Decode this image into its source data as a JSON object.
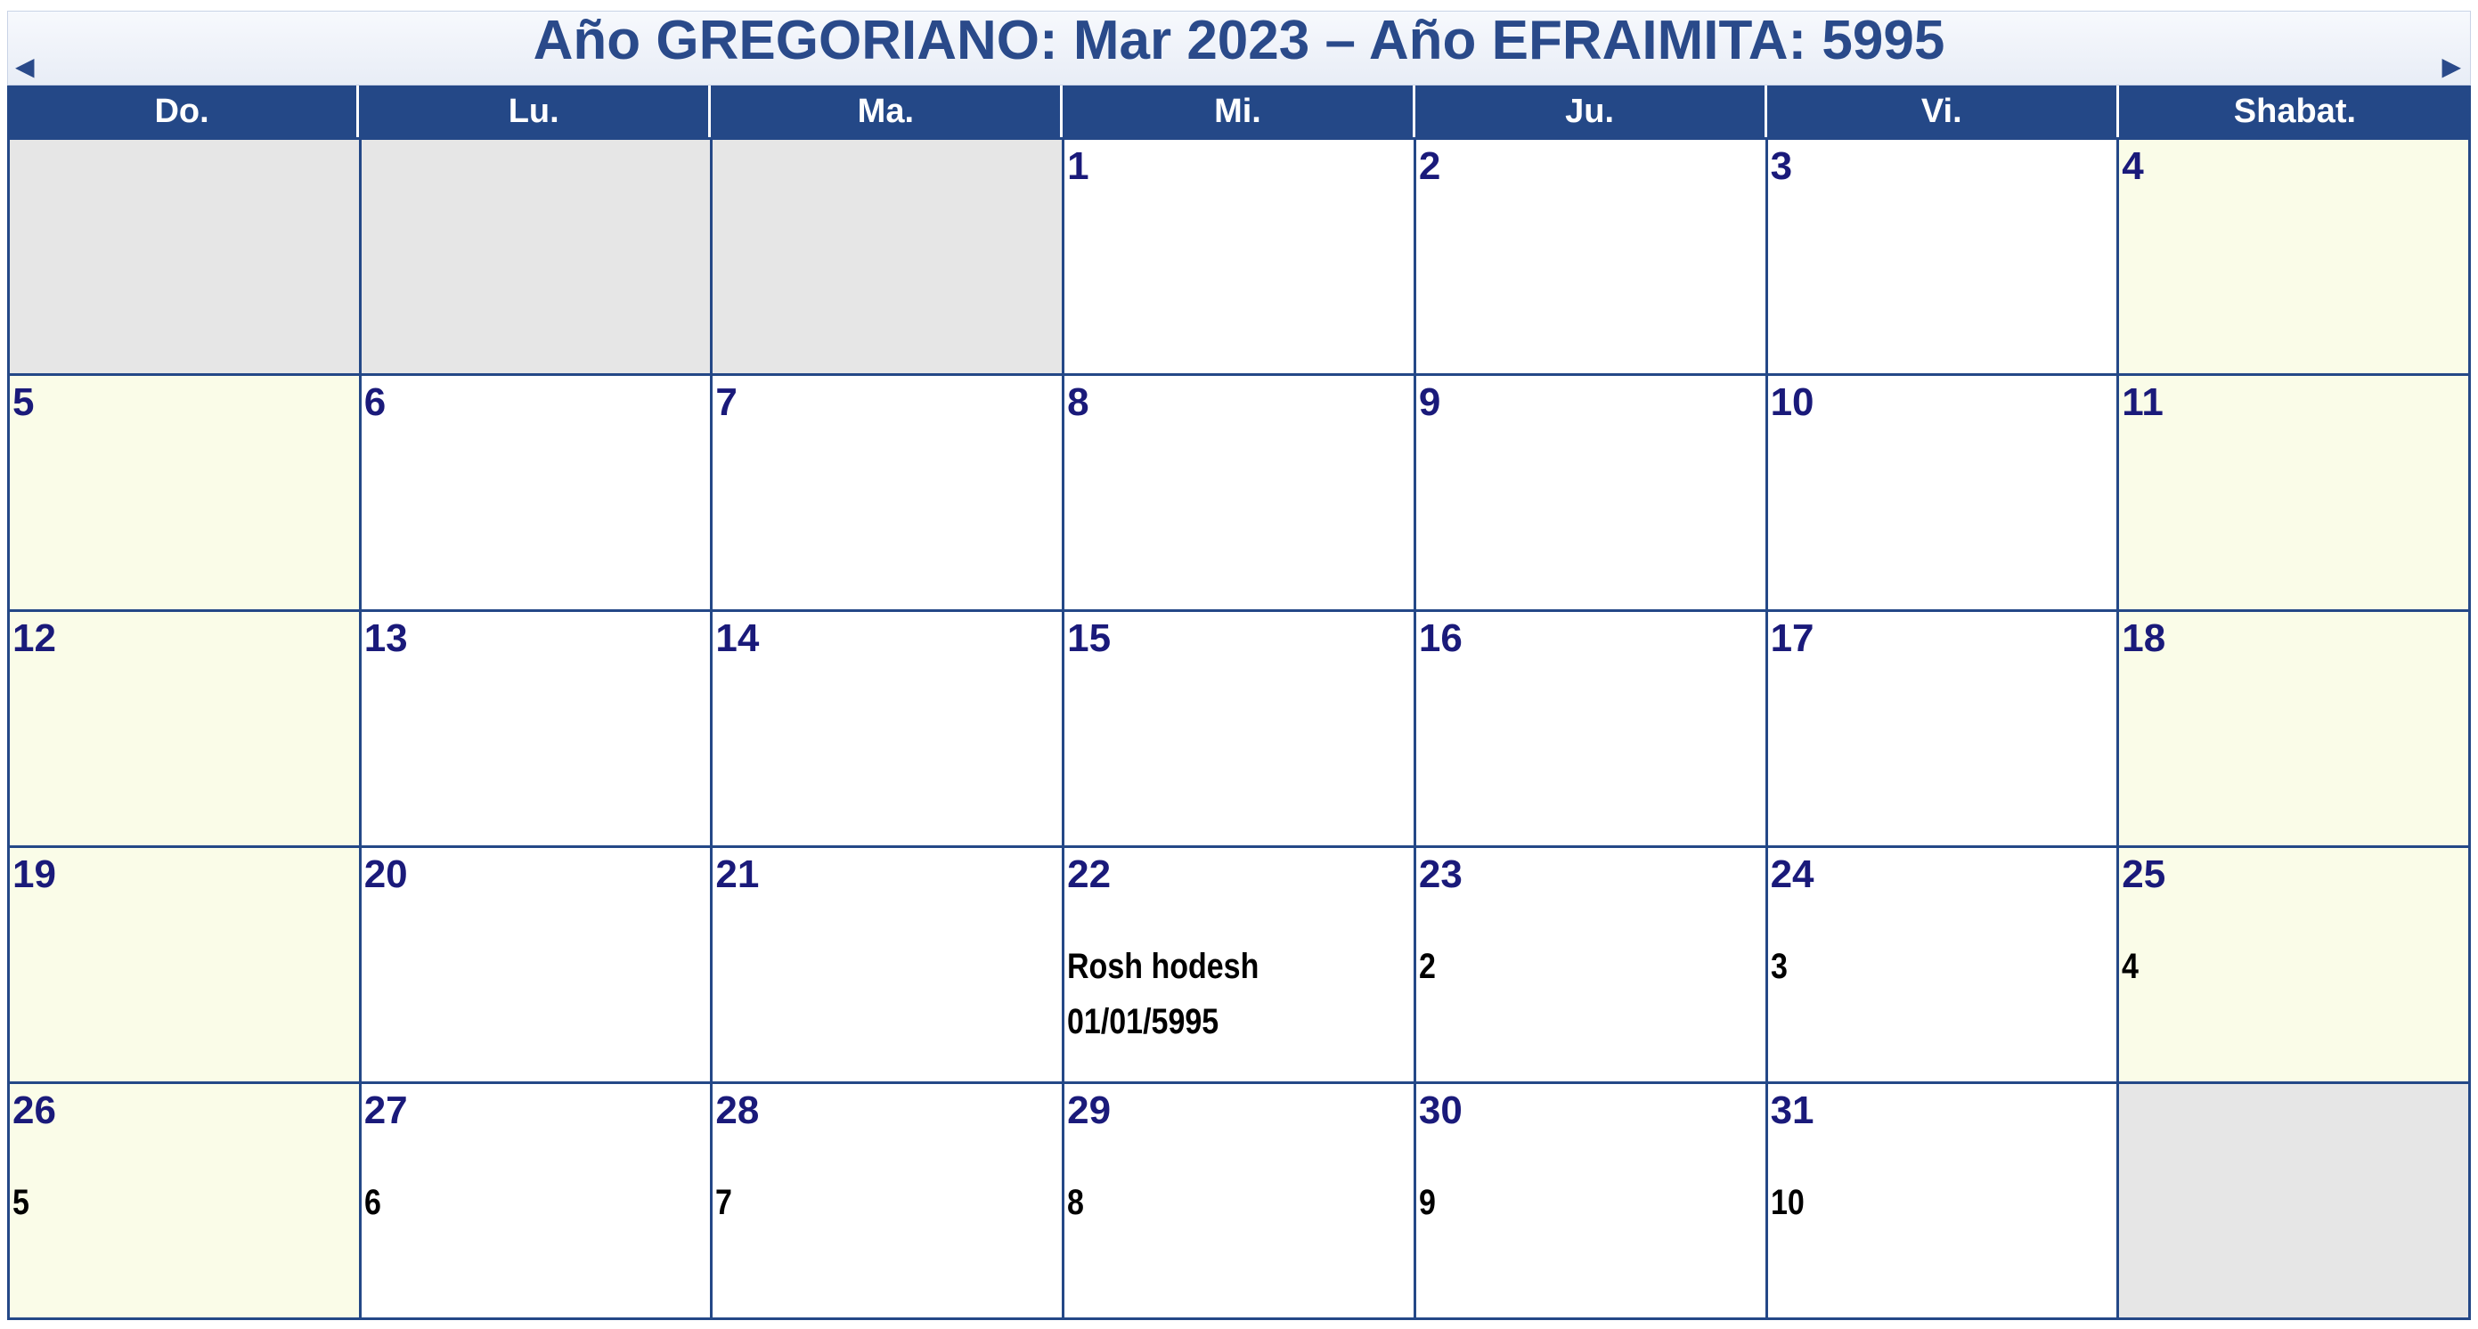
{
  "title": "Año GREGORIANO: Mar 2023 – Año EFRAIMITA: 5995",
  "nav": {
    "prev_icon": "◀",
    "next_icon": "▶"
  },
  "weekdays": [
    "Do.",
    "Lu.",
    "Ma.",
    "Mi.",
    "Ju.",
    "Vi.",
    "Shabat."
  ],
  "colors": {
    "header_bg": "#244887",
    "title_color": "#2a4a8a",
    "day_number_color": "#1a1a7a",
    "empty_cell_bg": "#e6e6e6",
    "shabbat_bg": "#fafce8"
  },
  "weeks": [
    [
      {
        "day": "",
        "note": "",
        "empty": true
      },
      {
        "day": "",
        "note": "",
        "empty": true
      },
      {
        "day": "",
        "note": "",
        "empty": true
      },
      {
        "day": "1",
        "note": ""
      },
      {
        "day": "2",
        "note": ""
      },
      {
        "day": "3",
        "note": ""
      },
      {
        "day": "4",
        "note": ""
      }
    ],
    [
      {
        "day": "5",
        "note": ""
      },
      {
        "day": "6",
        "note": ""
      },
      {
        "day": "7",
        "note": ""
      },
      {
        "day": "8",
        "note": ""
      },
      {
        "day": "9",
        "note": ""
      },
      {
        "day": "10",
        "note": ""
      },
      {
        "day": "11",
        "note": ""
      }
    ],
    [
      {
        "day": "12",
        "note": ""
      },
      {
        "day": "13",
        "note": ""
      },
      {
        "day": "14",
        "note": ""
      },
      {
        "day": "15",
        "note": ""
      },
      {
        "day": "16",
        "note": ""
      },
      {
        "day": "17",
        "note": ""
      },
      {
        "day": "18",
        "note": ""
      }
    ],
    [
      {
        "day": "19",
        "note": ""
      },
      {
        "day": "20",
        "note": ""
      },
      {
        "day": "21",
        "note": ""
      },
      {
        "day": "22",
        "note": "Rosh hodesh\n01/01/5995"
      },
      {
        "day": "23",
        "note": "2"
      },
      {
        "day": "24",
        "note": "3"
      },
      {
        "day": "25",
        "note": "4"
      }
    ],
    [
      {
        "day": "26",
        "note": "5"
      },
      {
        "day": "27",
        "note": "6"
      },
      {
        "day": "28",
        "note": "7"
      },
      {
        "day": "29",
        "note": "8"
      },
      {
        "day": "30",
        "note": "9"
      },
      {
        "day": "31",
        "note": "10"
      },
      {
        "day": "",
        "note": "",
        "empty": true
      }
    ]
  ]
}
